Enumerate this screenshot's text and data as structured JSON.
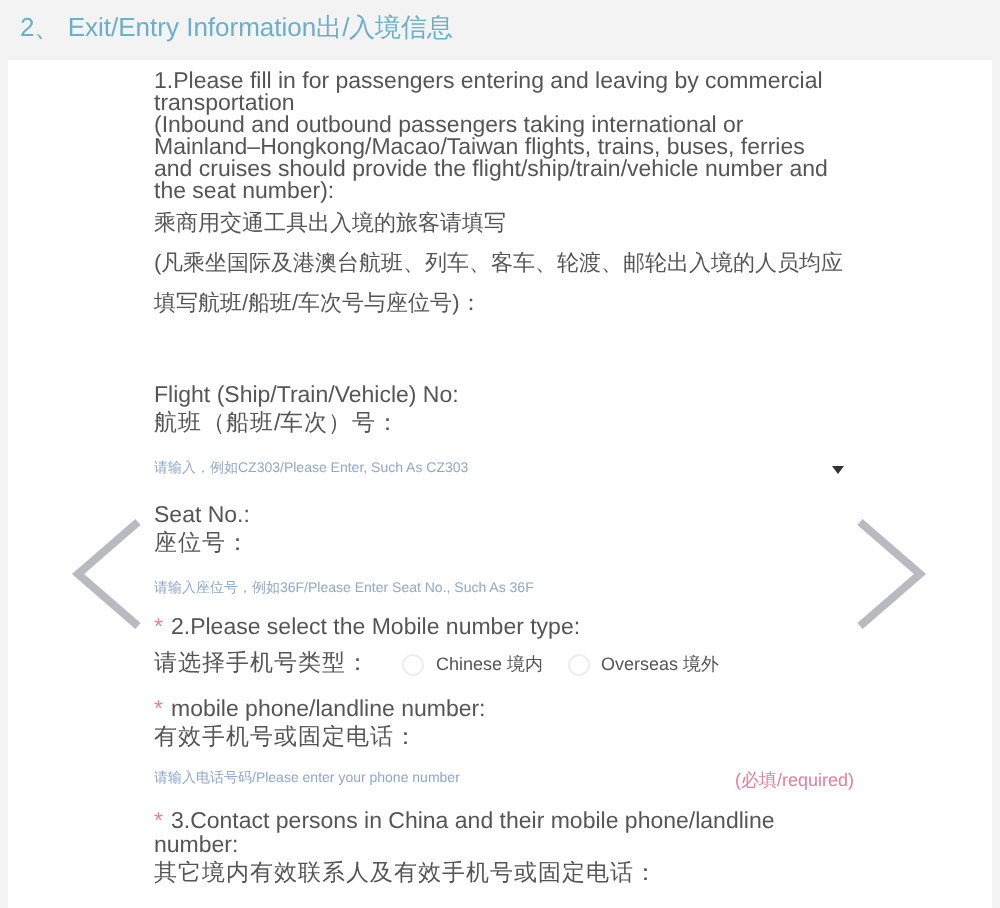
{
  "section_heading": "2、 Exit/Entry Information出/入境信息",
  "intro": {
    "english": "1.Please fill in for passengers entering and leaving by commercial transportation\n(Inbound and outbound passengers taking international or Mainland–Hongkong/Macao/Taiwan flights, trains, buses, ferries and cruises should provide the flight/ship/train/vehicle number and the seat number):",
    "chinese": [
      "乘商用交通工具出入境的旅客请填写",
      "(凡乘坐国际及港澳台航班、列车、客车、轮渡、邮轮出入境的人员均应填写航班/船班/车次号与座位号)："
    ]
  },
  "flight": {
    "label_en": "Flight (Ship/Train/Vehicle) No:",
    "label_zh": "航班（船班/车次）号：",
    "placeholder": "请输入，例如CZ303/Please Enter, Such As CZ303"
  },
  "seat": {
    "label_en": "Seat No.:",
    "label_zh": "座位号：",
    "placeholder": "请输入座位号，例如36F/Please Enter Seat No., Such As 36F"
  },
  "mobile_type": {
    "required_mark": "*",
    "label_en": "2.Please select the Mobile number type:",
    "label_zh": "请选择手机号类型：",
    "options": [
      {
        "label": "Chinese 境内",
        "selected": false
      },
      {
        "label": "Overseas 境外",
        "selected": false
      }
    ]
  },
  "phone": {
    "required_mark": "*",
    "label_en": "mobile phone/landline number:",
    "label_zh": "有效手机号或固定电话：",
    "placeholder": "请输入电话号码/Please enter your phone number",
    "required_note": "(必填/required)"
  },
  "contacts": {
    "required_mark": "*",
    "label_en": "3.Contact persons in China and their mobile phone/landline number:",
    "label_zh": "其它境内有效联系人及有效手机号或固定电话："
  }
}
